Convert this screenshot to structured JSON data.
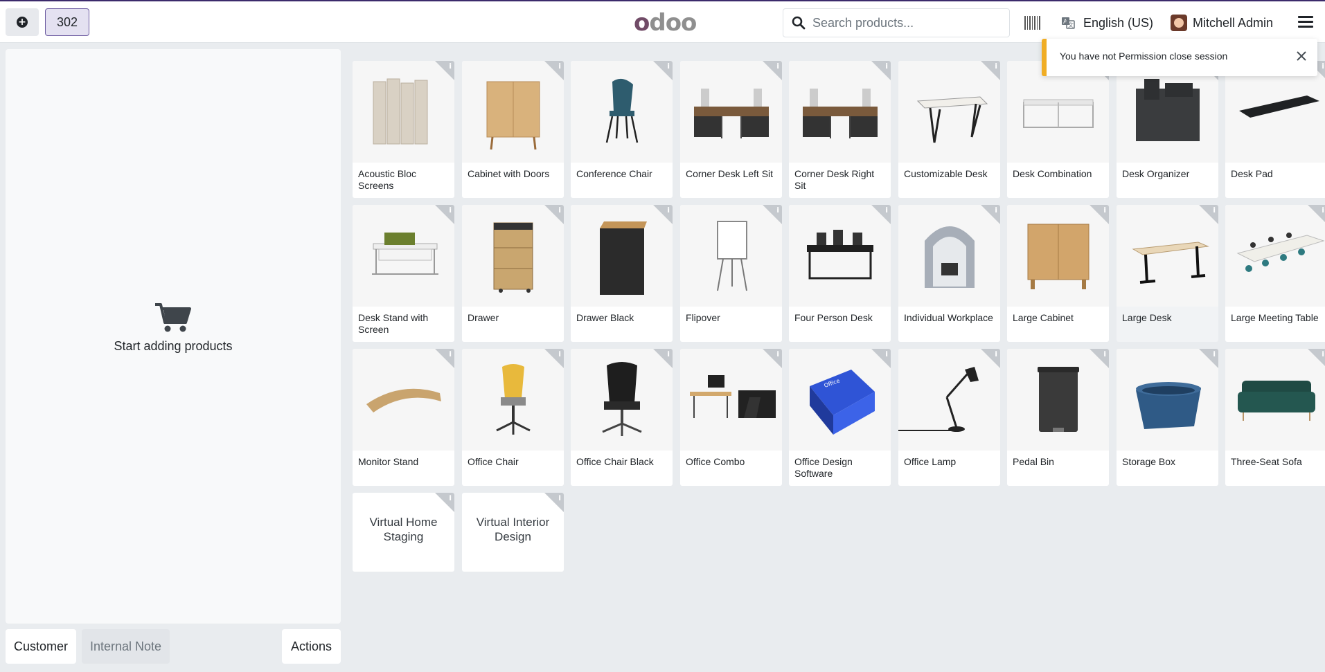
{
  "header": {
    "order_number": "302",
    "logo": "odoo",
    "search_placeholder": "Search products...",
    "language": "English (US)",
    "user": "Mitchell Admin"
  },
  "order_panel": {
    "empty_text": "Start adding products"
  },
  "footer_buttons": {
    "customer": "Customer",
    "internal_note": "Internal Note",
    "actions": "Actions"
  },
  "toast": {
    "message": "You have not Permission close session"
  },
  "products": [
    {
      "name": "Acoustic Bloc Screens",
      "icon": "acoustic-screen"
    },
    {
      "name": "Cabinet with Doors",
      "icon": "cabinet"
    },
    {
      "name": "Conference Chair",
      "icon": "chair"
    },
    {
      "name": "Corner Desk Left Sit",
      "icon": "desk-set"
    },
    {
      "name": "Corner Desk Right Sit",
      "icon": "desk-set"
    },
    {
      "name": "Customizable Desk",
      "icon": "table"
    },
    {
      "name": "Desk Combination",
      "icon": "desk-combo"
    },
    {
      "name": "Desk Organizer",
      "icon": "organizer"
    },
    {
      "name": "Desk Pad",
      "icon": "pad"
    },
    {
      "name": "Desk Stand with Screen",
      "icon": "stand-screen"
    },
    {
      "name": "Drawer",
      "icon": "drawer"
    },
    {
      "name": "Drawer Black",
      "icon": "drawer-black"
    },
    {
      "name": "Flipover",
      "icon": "flipover"
    },
    {
      "name": "Four Person Desk",
      "icon": "four-desk"
    },
    {
      "name": "Individual Workplace",
      "icon": "pod"
    },
    {
      "name": "Large Cabinet",
      "icon": "large-cabinet"
    },
    {
      "name": "Large Desk",
      "icon": "large-desk"
    },
    {
      "name": "Large Meeting Table",
      "icon": "meeting-table"
    },
    {
      "name": "Monitor Stand",
      "icon": "monitor-stand"
    },
    {
      "name": "Office Chair",
      "icon": "office-chair"
    },
    {
      "name": "Office Chair Black",
      "icon": "office-chair-black"
    },
    {
      "name": "Office Combo",
      "icon": "office-combo"
    },
    {
      "name": "Office Design Software",
      "icon": "software-box"
    },
    {
      "name": "Office Lamp",
      "icon": "lamp"
    },
    {
      "name": "Pedal Bin",
      "icon": "bin"
    },
    {
      "name": "Storage Box",
      "icon": "storage-box"
    },
    {
      "name": "Three-Seat Sofa",
      "icon": "sofa"
    },
    {
      "name": "Virtual Home Staging",
      "icon": ""
    },
    {
      "name": "Virtual Interior Design",
      "icon": ""
    }
  ],
  "selected_product_index": 16
}
